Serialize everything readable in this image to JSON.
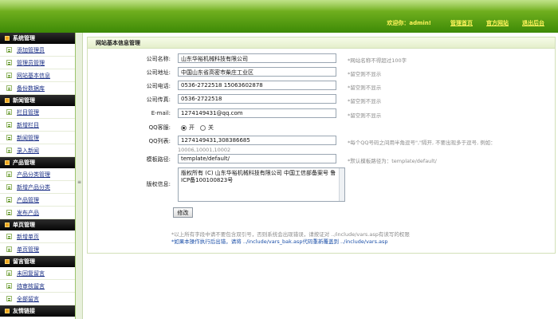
{
  "header": {
    "welcome": "欢迎你：admin!",
    "links": [
      "管理首页",
      "官方网站",
      "退出后台"
    ]
  },
  "sidebar": {
    "groups": [
      {
        "title": "系统管理",
        "items": [
          "添加管理员",
          "管理员管理",
          "网站基本信息",
          "备份数据库"
        ]
      },
      {
        "title": "新闻管理",
        "items": [
          "栏目管理",
          "新增栏目",
          "新闻管理",
          "录入新闻"
        ]
      },
      {
        "title": "产品管理",
        "items": [
          "产品分类管理",
          "新增产品分类",
          "产品管理",
          "发布产品"
        ]
      },
      {
        "title": "单页管理",
        "items": [
          "新增单页",
          "单页管理"
        ]
      },
      {
        "title": "留言管理",
        "items": [
          "未回复留言",
          "待审核留言",
          "全部留言"
        ]
      },
      {
        "title": "友情链接",
        "items": []
      }
    ]
  },
  "panel": {
    "title": "网站基本信息管理",
    "company_name": {
      "label": "公司名称:",
      "value": "山东华裕机械科技有限公司",
      "hint": "*网站名称不得超过100字"
    },
    "company_address": {
      "label": "公司地址:",
      "value": "中国山东省高密市柴庄工业区",
      "hint": "*留空则不显示"
    },
    "company_phone": {
      "label": "公司电话:",
      "value": "0536-2722518 15063602878",
      "hint": "*留空则不显示"
    },
    "company_fax": {
      "label": "公司传真:",
      "value": "0536-2722518",
      "hint": "*留空则不显示"
    },
    "email": {
      "label": "E-mail:",
      "value": "1274149431@qq.com",
      "hint": "*留空则不显示"
    },
    "qq_show": {
      "label": "QQ客服:",
      "on": "开",
      "off": "关",
      "selected": "开"
    },
    "qq_list": {
      "label": "QQ列表:",
      "value": "1274149431,308386685",
      "hint": "*每个QQ号码之间用半角逗号\",\"隔开, 不要出现多于逗号, 例如：",
      "example": "10006,10001,10002"
    },
    "template_path": {
      "label": "模板路径:",
      "value": "template/default/",
      "hint": "*默认模板路径为：template/default/"
    },
    "copyright": {
      "label": "版权信息:",
      "value": "版权所有 (C) 山东华裕机械科技有限公司  中国工信部备案号  鲁ICP备100100823号"
    },
    "submit_label": "修改",
    "note1": "*以上所有字段中请不要包含双引号，否则系统会出现错误，请按证对 ../include/vars.asp有读写的权限",
    "note2": "*如果本操作执行后出错，请将 ../include/vars_bak.asp代码重新覆盖到 ../include/vars.asp"
  }
}
